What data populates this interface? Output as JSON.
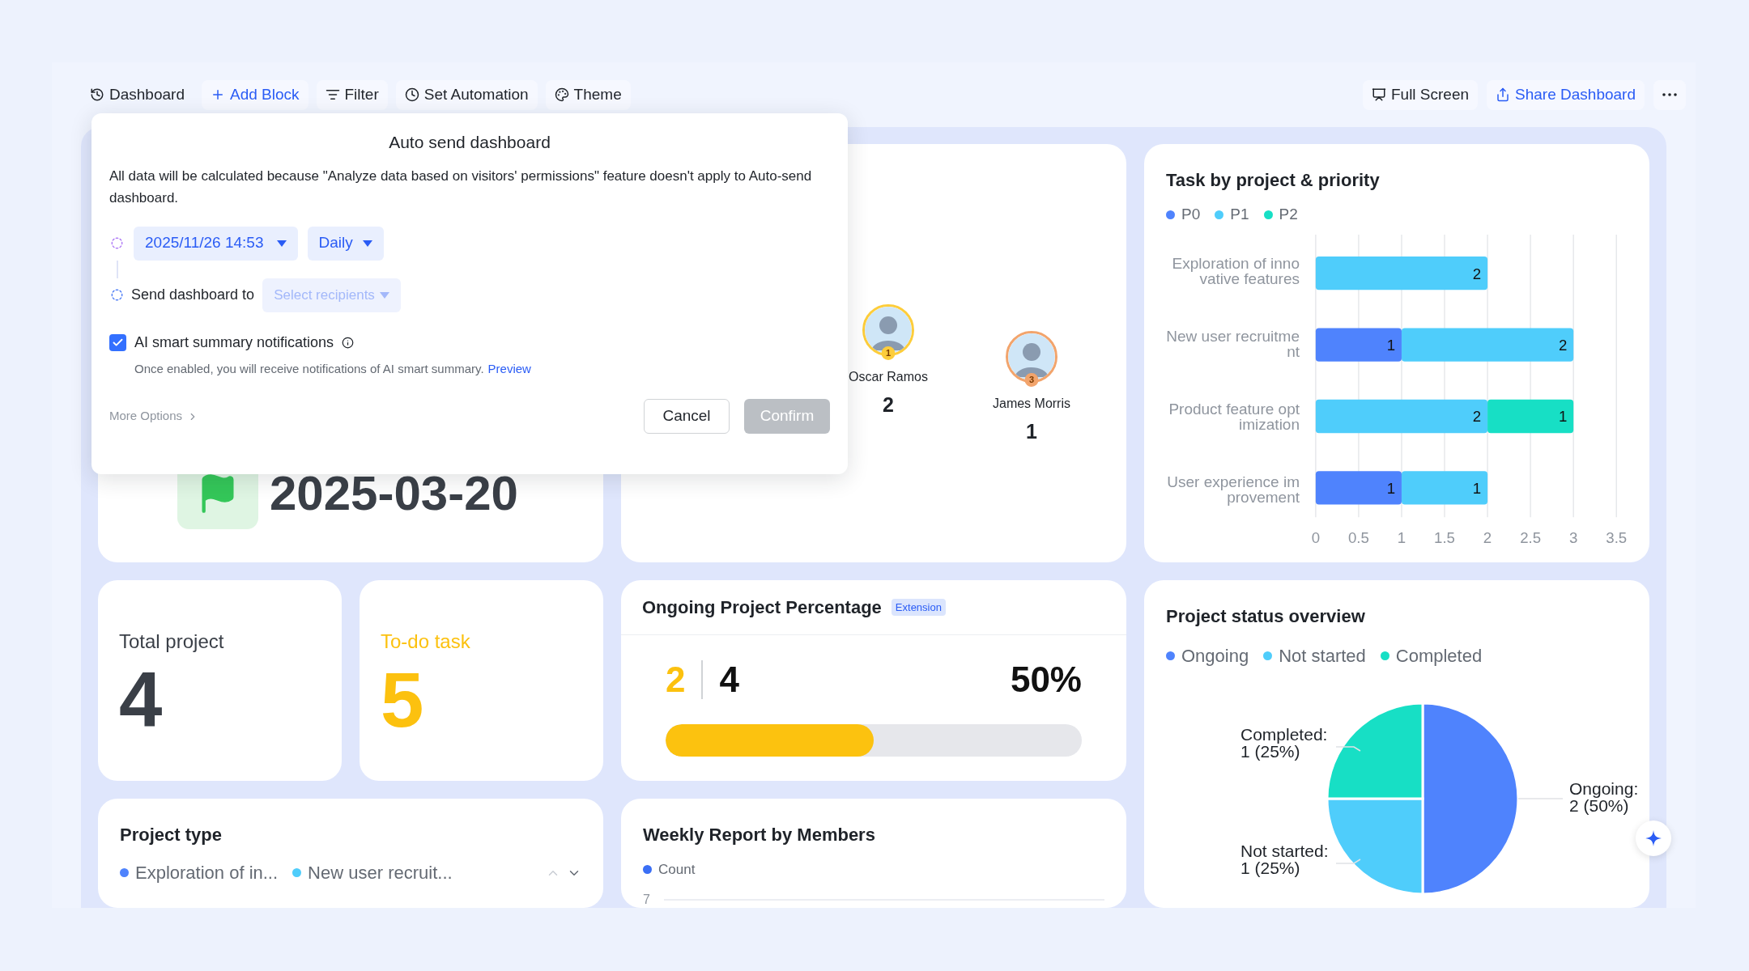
{
  "toolbar": {
    "left": [
      {
        "kind": "dashboard",
        "label": "Dashboard"
      },
      {
        "kind": "add",
        "label": "Add Block"
      },
      {
        "kind": "filter",
        "label": "Filter"
      },
      {
        "kind": "automation",
        "label": "Set Automation"
      },
      {
        "kind": "theme",
        "label": "Theme"
      }
    ],
    "right": [
      {
        "kind": "fullscreen",
        "label": "Full Screen"
      },
      {
        "kind": "share",
        "label": "Share Dashboard"
      },
      {
        "kind": "more"
      }
    ]
  },
  "milestone": {
    "date": "2025-03-20"
  },
  "leaderboard": [
    {
      "name": "Oscar Ramos",
      "rank": "1",
      "count": "2",
      "color": "#fdcd3b"
    },
    {
      "name": "James Morris",
      "rank": "3",
      "count": "1",
      "color": "#f2a46c"
    }
  ],
  "task_chart": {
    "title": "Task by project & priority",
    "chart_data": {
      "type": "bar",
      "orientation": "horizontal",
      "stacked": true,
      "grid": true,
      "data_labels": true,
      "categories": [
        "Exploration of innovative features",
        "New user recruitment",
        "Product feature optimization",
        "User experience improvement"
      ],
      "xlim": [
        0,
        3.5
      ],
      "xticks": [
        0,
        0.5,
        1,
        1.5,
        2,
        2.5,
        3,
        3.5
      ],
      "series": [
        {
          "name": "P0",
          "color": "#4f83fd",
          "values": [
            null,
            1,
            null,
            1
          ]
        },
        {
          "name": "P1",
          "color": "#4fcdfb",
          "values": [
            2,
            2,
            2,
            1
          ]
        },
        {
          "name": "P2",
          "color": "#17dfc5",
          "values": [
            null,
            null,
            1,
            null
          ]
        }
      ]
    }
  },
  "stats": [
    {
      "kind": "neutral",
      "label": "Total project",
      "value": "4"
    },
    {
      "kind": "highlight",
      "label": "To-do task",
      "value": "5"
    }
  ],
  "progress": {
    "title": "Ongoing Project Percentage",
    "badge": "Extension",
    "done": "2",
    "total": "4",
    "percent": "50%",
    "level": 0.5
  },
  "project_type": {
    "title": "Project type",
    "legend": [
      {
        "label": "Exploration of in...",
        "color": "#4f83fd"
      },
      {
        "label": "New user recruit...",
        "color": "#4fcdfb"
      }
    ]
  },
  "weekly": {
    "title": "Weekly Report by Members",
    "legend": [
      {
        "label": "Count",
        "color": "#3b6ff5"
      }
    ],
    "y_tick": "7"
  },
  "status": {
    "title": "Project status overview",
    "legend": [
      {
        "label": "Ongoing",
        "color": "#4f83fd"
      },
      {
        "label": "Not started",
        "color": "#4fcdfb"
      },
      {
        "label": "Completed",
        "color": "#17dfc5"
      }
    ],
    "chart_data": {
      "type": "pie",
      "categories": [
        "Ongoing",
        "Not started",
        "Completed"
      ],
      "values": [
        2,
        1,
        1
      ],
      "colors": [
        "#4f83fd",
        "#4fcdfb",
        "#17dfc5"
      ],
      "value_labels": [
        "2 (50%)",
        "1 (25%)",
        "1 (25%)"
      ]
    },
    "label_separator": ":"
  },
  "dialog": {
    "title": "Auto send dashboard",
    "notice": "All data will be calculated because \"Analyze data based on visitors' permissions\" feature doesn't apply to Auto-send dashboard.",
    "schedule": {
      "datetime": "2025/11/26 14:53",
      "frequency": "Daily"
    },
    "recipients": {
      "label": "Send dashboard to",
      "placeholder": "Select recipients"
    },
    "ai_summary": {
      "label": "AI smart summary notifications",
      "checked": true,
      "hint": "Once enabled, you will receive notifications of AI smart summary.",
      "link": "Preview"
    },
    "more_options": "More Options",
    "buttons": [
      {
        "kind": "secondary",
        "label": "Cancel",
        "disabled": false
      },
      {
        "kind": "primary",
        "label": "Confirm",
        "disabled": true
      }
    ]
  }
}
